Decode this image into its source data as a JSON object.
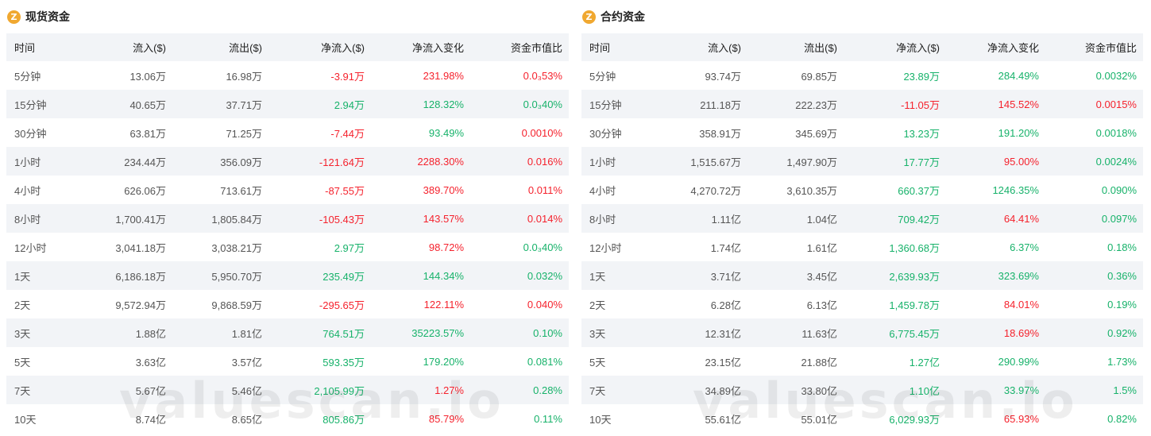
{
  "columns": [
    "时间",
    "流入($)",
    "流出($)",
    "净流入($)",
    "净流入变化",
    "资金市值比"
  ],
  "spot": {
    "title": "现货资金",
    "icon": "coin-icon",
    "rows": [
      {
        "time": "5分钟",
        "inflow": "13.06万",
        "outflow": "16.98万",
        "net": "-3.91万",
        "net_sign": "neg",
        "change": "231.98%",
        "change_sign": "neg",
        "ratio": "0.0₃53%",
        "ratio_sign": "neg"
      },
      {
        "time": "15分钟",
        "inflow": "40.65万",
        "outflow": "37.71万",
        "net": "2.94万",
        "net_sign": "pos",
        "change": "128.32%",
        "change_sign": "pos",
        "ratio": "0.0₃40%",
        "ratio_sign": "pos"
      },
      {
        "time": "30分钟",
        "inflow": "63.81万",
        "outflow": "71.25万",
        "net": "-7.44万",
        "net_sign": "neg",
        "change": "93.49%",
        "change_sign": "pos",
        "ratio": "0.0010%",
        "ratio_sign": "neg"
      },
      {
        "time": "1小时",
        "inflow": "234.44万",
        "outflow": "356.09万",
        "net": "-121.64万",
        "net_sign": "neg",
        "change": "2288.30%",
        "change_sign": "neg",
        "ratio": "0.016%",
        "ratio_sign": "neg"
      },
      {
        "time": "4小时",
        "inflow": "626.06万",
        "outflow": "713.61万",
        "net": "-87.55万",
        "net_sign": "neg",
        "change": "389.70%",
        "change_sign": "neg",
        "ratio": "0.011%",
        "ratio_sign": "neg"
      },
      {
        "time": "8小时",
        "inflow": "1,700.41万",
        "outflow": "1,805.84万",
        "net": "-105.43万",
        "net_sign": "neg",
        "change": "143.57%",
        "change_sign": "neg",
        "ratio": "0.014%",
        "ratio_sign": "neg"
      },
      {
        "time": "12小时",
        "inflow": "3,041.18万",
        "outflow": "3,038.21万",
        "net": "2.97万",
        "net_sign": "pos",
        "change": "98.72%",
        "change_sign": "neg",
        "ratio": "0.0₃40%",
        "ratio_sign": "pos"
      },
      {
        "time": "1天",
        "inflow": "6,186.18万",
        "outflow": "5,950.70万",
        "net": "235.49万",
        "net_sign": "pos",
        "change": "144.34%",
        "change_sign": "pos",
        "ratio": "0.032%",
        "ratio_sign": "pos"
      },
      {
        "time": "2天",
        "inflow": "9,572.94万",
        "outflow": "9,868.59万",
        "net": "-295.65万",
        "net_sign": "neg",
        "change": "122.11%",
        "change_sign": "neg",
        "ratio": "0.040%",
        "ratio_sign": "neg"
      },
      {
        "time": "3天",
        "inflow": "1.88亿",
        "outflow": "1.81亿",
        "net": "764.51万",
        "net_sign": "pos",
        "change": "35223.57%",
        "change_sign": "pos",
        "ratio": "0.10%",
        "ratio_sign": "pos"
      },
      {
        "time": "5天",
        "inflow": "3.63亿",
        "outflow": "3.57亿",
        "net": "593.35万",
        "net_sign": "pos",
        "change": "179.20%",
        "change_sign": "pos",
        "ratio": "0.081%",
        "ratio_sign": "pos"
      },
      {
        "time": "7天",
        "inflow": "5.67亿",
        "outflow": "5.46亿",
        "net": "2,105.99万",
        "net_sign": "pos",
        "change": "1.27%",
        "change_sign": "neg",
        "ratio": "0.28%",
        "ratio_sign": "pos"
      },
      {
        "time": "10天",
        "inflow": "8.74亿",
        "outflow": "8.65亿",
        "net": "805.86万",
        "net_sign": "pos",
        "change": "85.79%",
        "change_sign": "neg",
        "ratio": "0.11%",
        "ratio_sign": "pos"
      }
    ]
  },
  "contract": {
    "title": "合约资金",
    "icon": "coin-icon",
    "rows": [
      {
        "time": "5分钟",
        "inflow": "93.74万",
        "outflow": "69.85万",
        "net": "23.89万",
        "net_sign": "pos",
        "change": "284.49%",
        "change_sign": "pos",
        "ratio": "0.0032%",
        "ratio_sign": "pos"
      },
      {
        "time": "15分钟",
        "inflow": "211.18万",
        "outflow": "222.23万",
        "net": "-11.05万",
        "net_sign": "neg",
        "change": "145.52%",
        "change_sign": "neg",
        "ratio": "0.0015%",
        "ratio_sign": "neg"
      },
      {
        "time": "30分钟",
        "inflow": "358.91万",
        "outflow": "345.69万",
        "net": "13.23万",
        "net_sign": "pos",
        "change": "191.20%",
        "change_sign": "pos",
        "ratio": "0.0018%",
        "ratio_sign": "pos"
      },
      {
        "time": "1小时",
        "inflow": "1,515.67万",
        "outflow": "1,497.90万",
        "net": "17.77万",
        "net_sign": "pos",
        "change": "95.00%",
        "change_sign": "neg",
        "ratio": "0.0024%",
        "ratio_sign": "pos"
      },
      {
        "time": "4小时",
        "inflow": "4,270.72万",
        "outflow": "3,610.35万",
        "net": "660.37万",
        "net_sign": "pos",
        "change": "1246.35%",
        "change_sign": "pos",
        "ratio": "0.090%",
        "ratio_sign": "pos"
      },
      {
        "time": "8小时",
        "inflow": "1.11亿",
        "outflow": "1.04亿",
        "net": "709.42万",
        "net_sign": "pos",
        "change": "64.41%",
        "change_sign": "neg",
        "ratio": "0.097%",
        "ratio_sign": "pos"
      },
      {
        "time": "12小时",
        "inflow": "1.74亿",
        "outflow": "1.61亿",
        "net": "1,360.68万",
        "net_sign": "pos",
        "change": "6.37%",
        "change_sign": "pos",
        "ratio": "0.18%",
        "ratio_sign": "pos"
      },
      {
        "time": "1天",
        "inflow": "3.71亿",
        "outflow": "3.45亿",
        "net": "2,639.93万",
        "net_sign": "pos",
        "change": "323.69%",
        "change_sign": "pos",
        "ratio": "0.36%",
        "ratio_sign": "pos"
      },
      {
        "time": "2天",
        "inflow": "6.28亿",
        "outflow": "6.13亿",
        "net": "1,459.78万",
        "net_sign": "pos",
        "change": "84.01%",
        "change_sign": "neg",
        "ratio": "0.19%",
        "ratio_sign": "pos"
      },
      {
        "time": "3天",
        "inflow": "12.31亿",
        "outflow": "11.63亿",
        "net": "6,775.45万",
        "net_sign": "pos",
        "change": "18.69%",
        "change_sign": "neg",
        "ratio": "0.92%",
        "ratio_sign": "pos"
      },
      {
        "time": "5天",
        "inflow": "23.15亿",
        "outflow": "21.88亿",
        "net": "1.27亿",
        "net_sign": "pos",
        "change": "290.99%",
        "change_sign": "pos",
        "ratio": "1.73%",
        "ratio_sign": "pos"
      },
      {
        "time": "7天",
        "inflow": "34.89亿",
        "outflow": "33.80亿",
        "net": "1.10亿",
        "net_sign": "pos",
        "change": "33.97%",
        "change_sign": "pos",
        "ratio": "1.5%",
        "ratio_sign": "pos"
      },
      {
        "time": "10天",
        "inflow": "55.61亿",
        "outflow": "55.01亿",
        "net": "6,029.93万",
        "net_sign": "pos",
        "change": "65.93%",
        "change_sign": "neg",
        "ratio": "0.82%",
        "ratio_sign": "pos"
      }
    ]
  },
  "watermark": "valuescan.io",
  "colors": {
    "positive": "#17b26a",
    "negative": "#f5222d",
    "header_bg": "#f2f4f7",
    "coin": "#f0a830"
  }
}
